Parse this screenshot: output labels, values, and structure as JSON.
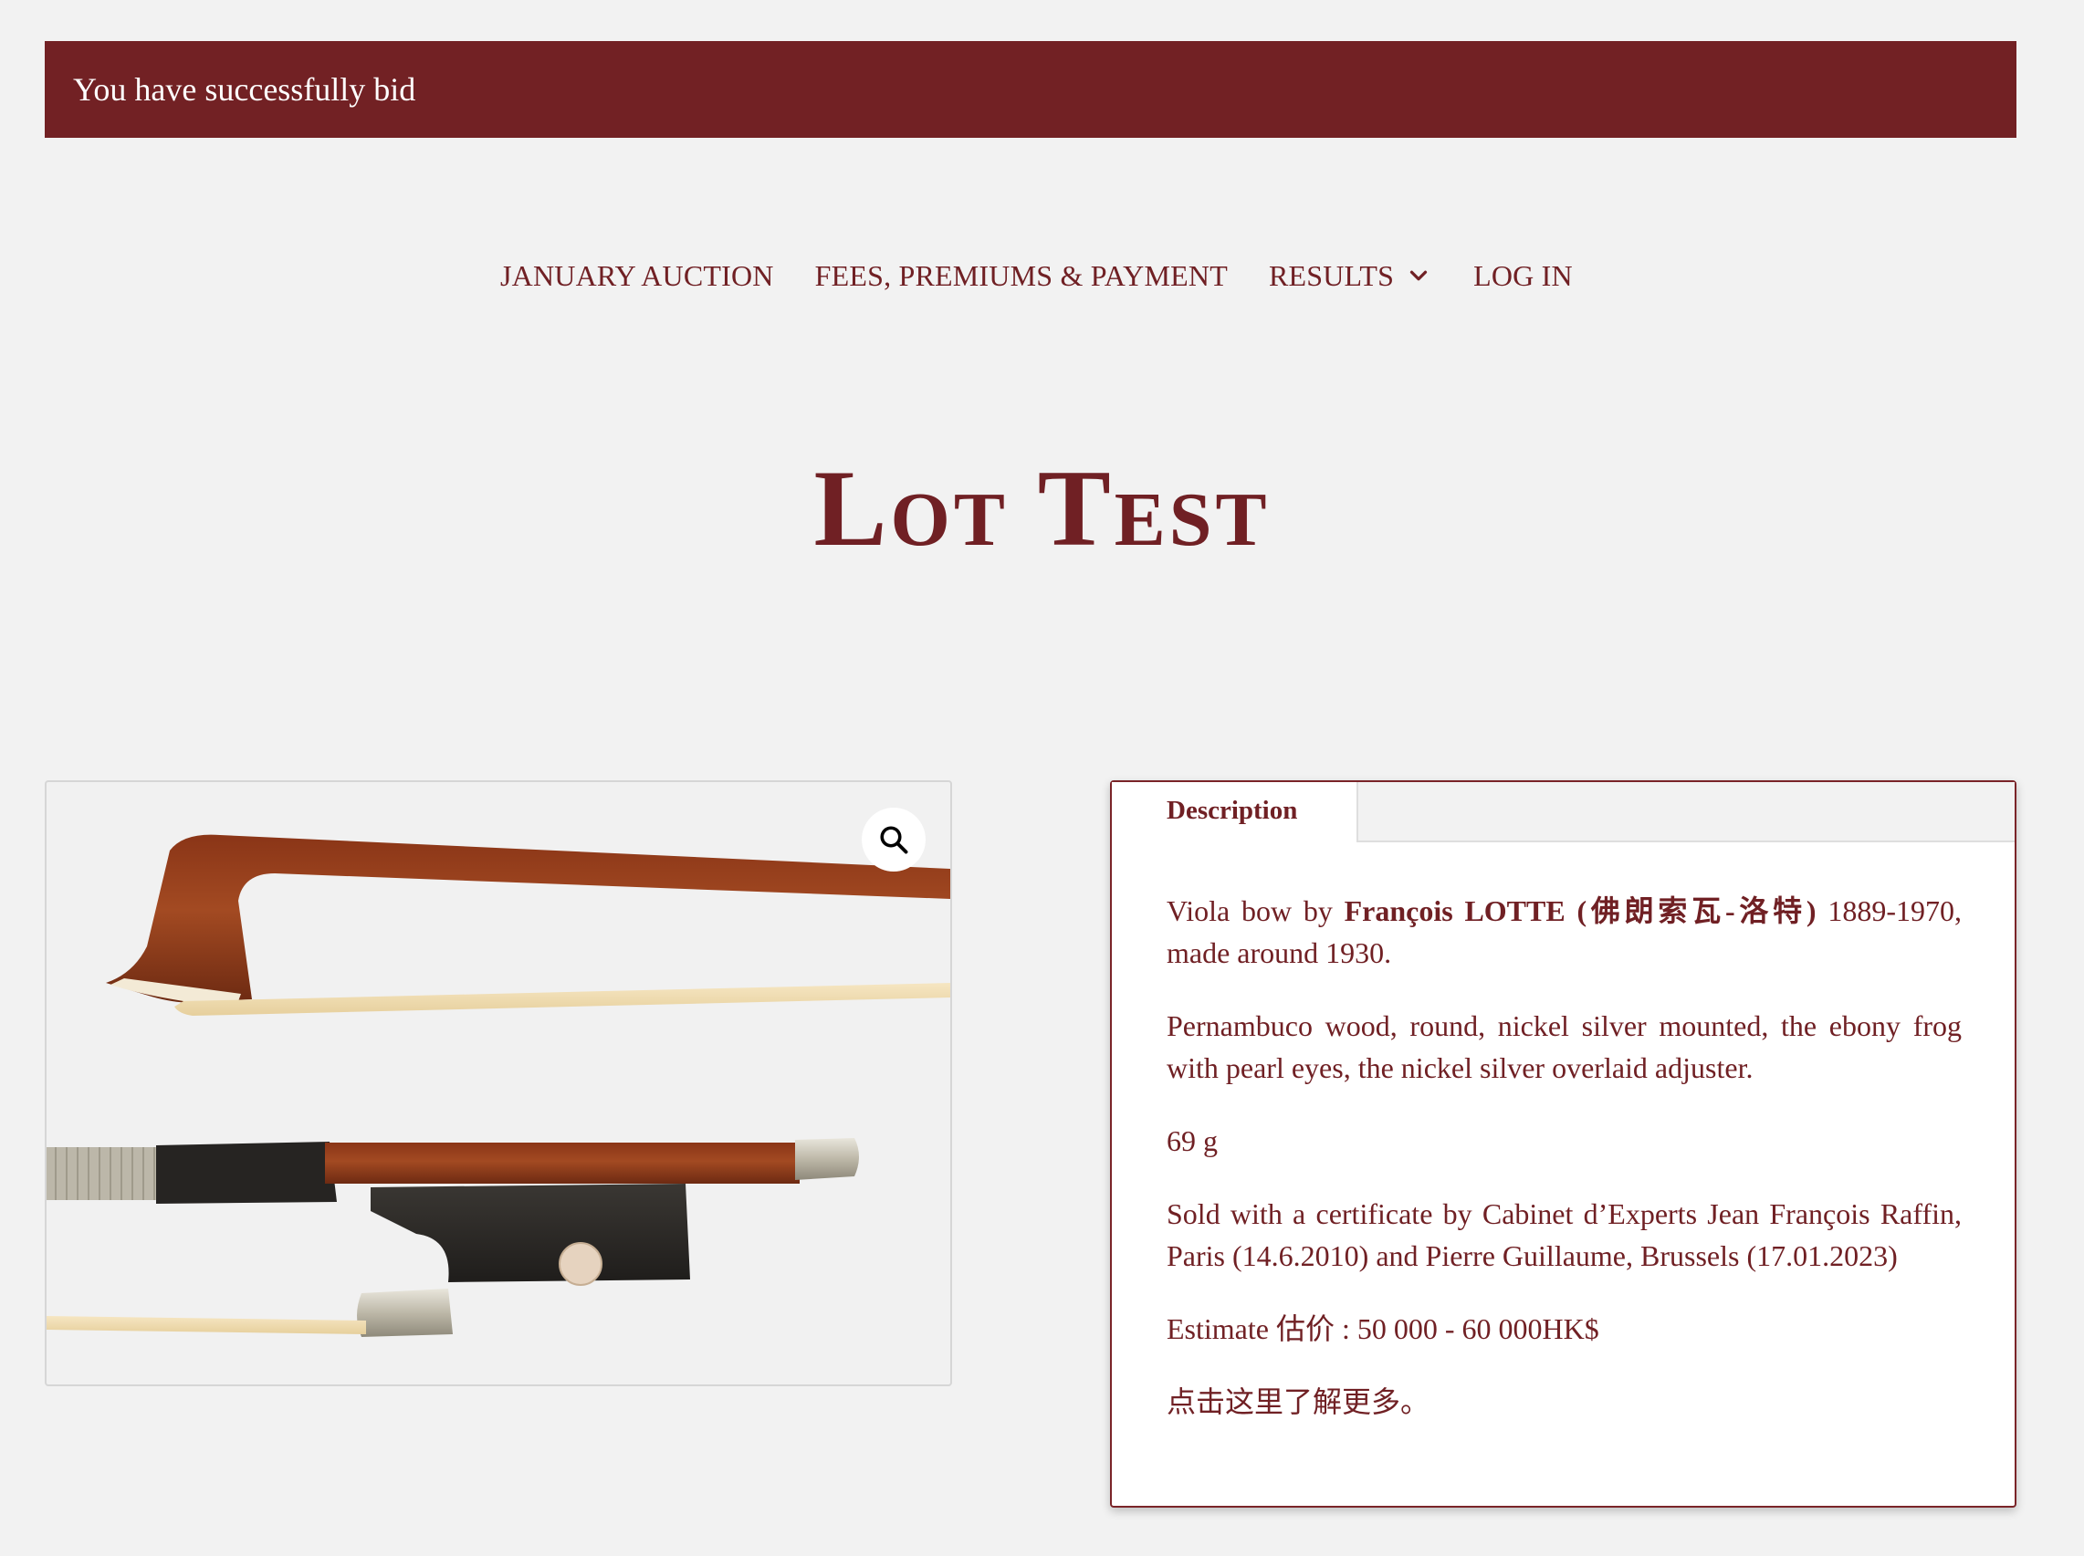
{
  "notice": {
    "message": "You have successfully bid"
  },
  "nav": {
    "items": [
      {
        "label": "JANUARY AUCTION"
      },
      {
        "label": "FEES, PREMIUMS & PAYMENT"
      },
      {
        "label": "RESULTS"
      },
      {
        "label": "LOG IN"
      }
    ]
  },
  "page": {
    "title": "Lot Test"
  },
  "gallery": {
    "image_alt": "Viola bow head and frog"
  },
  "tabs": {
    "active_label": "Description"
  },
  "description": {
    "p1_prefix": "Viola bow by ",
    "p1_maker": "François LOTTE (佛朗索瓦-洛特)",
    "p1_suffix": " 1889-1970, made around 1930.",
    "p2": "Pernambuco wood, round, nickel silver mounted, the ebony frog with pearl eyes, the nickel silver overlaid adjuster.",
    "p3": "69 g",
    "p4": "Sold with a certificate by Cabinet d’Experts Jean François Raffin, Paris (14.6.2010) and Pierre Guillaume, Brussels (17.01.2023)",
    "p5": "Estimate 估价 : 50 000 - 60 000HK$",
    "p6": "点击这里了解更多。"
  },
  "colors": {
    "brand": "#722124",
    "text": "#702024",
    "background": "#f2f2f2"
  },
  "icons": {
    "zoom": "magnifier-icon",
    "dropdown": "chevron-down-icon"
  }
}
